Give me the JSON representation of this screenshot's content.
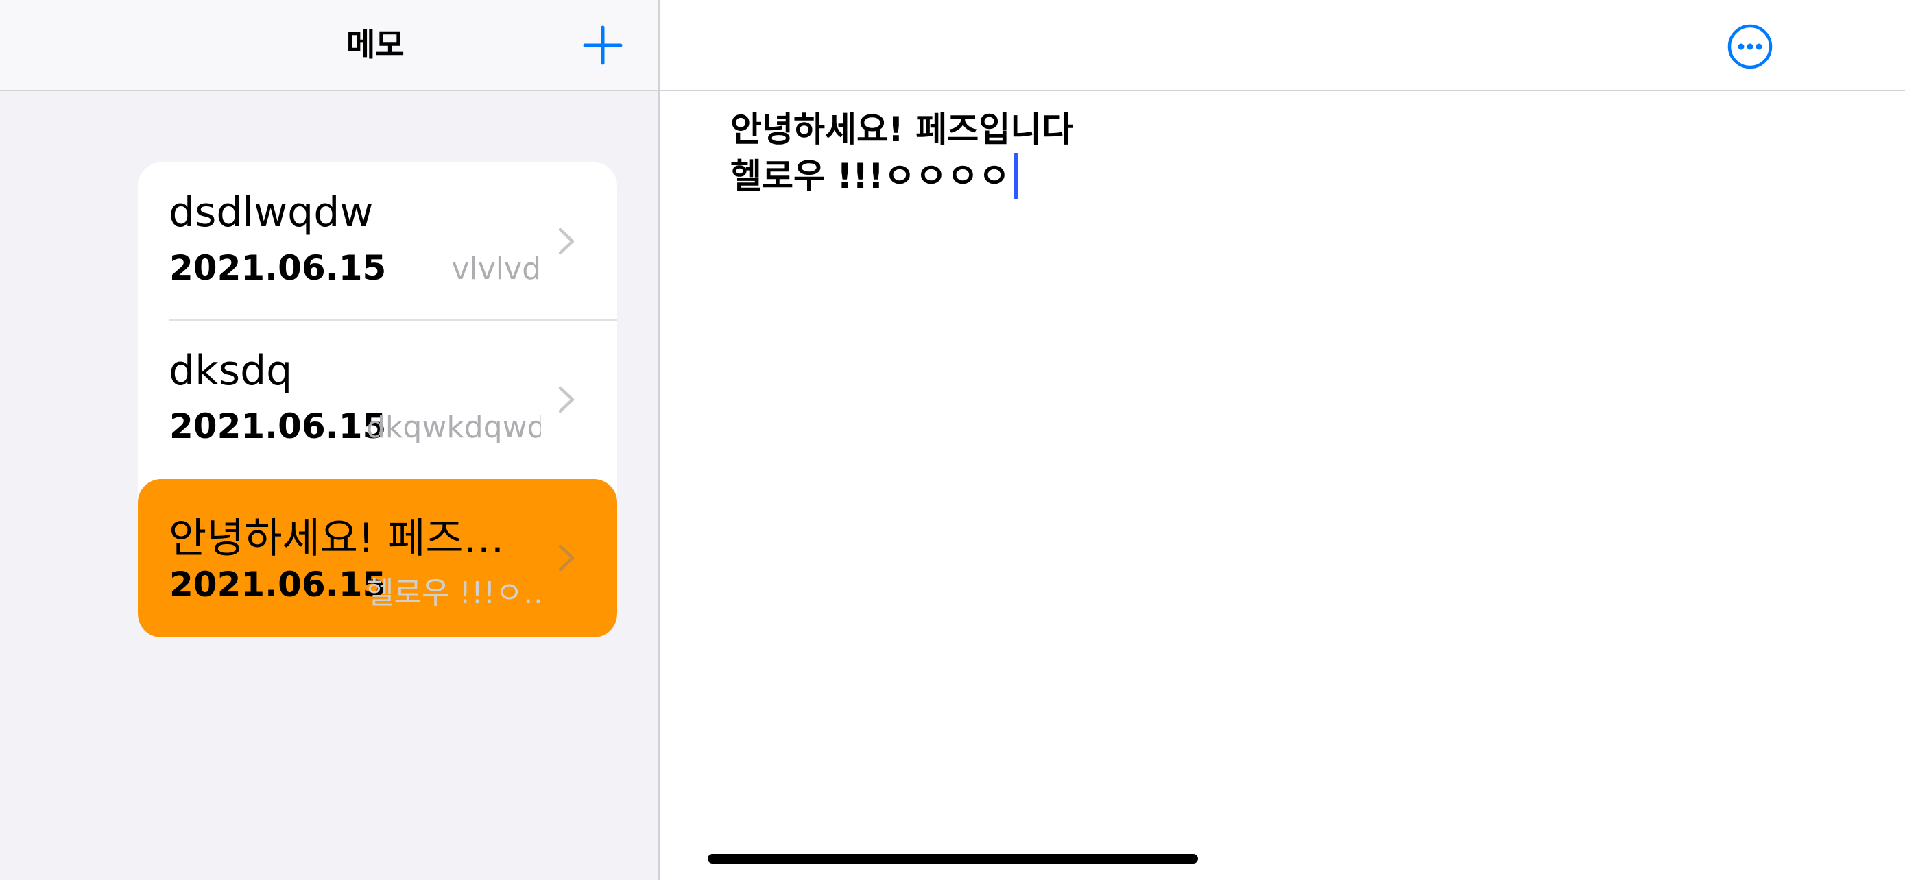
{
  "sidebar": {
    "title": "메모",
    "add_icon": "plus-icon",
    "memos": [
      {
        "title": "dsdlwqdw",
        "date": "2021.06.15",
        "preview": "vlvlvd",
        "selected": false
      },
      {
        "title": "dksdq",
        "date": "2021.06.15",
        "preview": "dkqwkdqwd",
        "selected": false
      },
      {
        "title": "안녕하세요! 페즈…",
        "date": "2021.06.15",
        "preview": "헬로우 !!!ㅇ…",
        "selected": true
      }
    ]
  },
  "detail": {
    "more_icon": "ellipsis-circle-icon",
    "lines": [
      "안녕하세요! 페즈입니다",
      "헬로우 !!!ㅇㅇㅇㅇ"
    ]
  },
  "colors": {
    "accent": "#007aff",
    "selected_row": "#ff9500",
    "background_sidebar": "#f2f2f7",
    "caret": "#2e5bff"
  }
}
